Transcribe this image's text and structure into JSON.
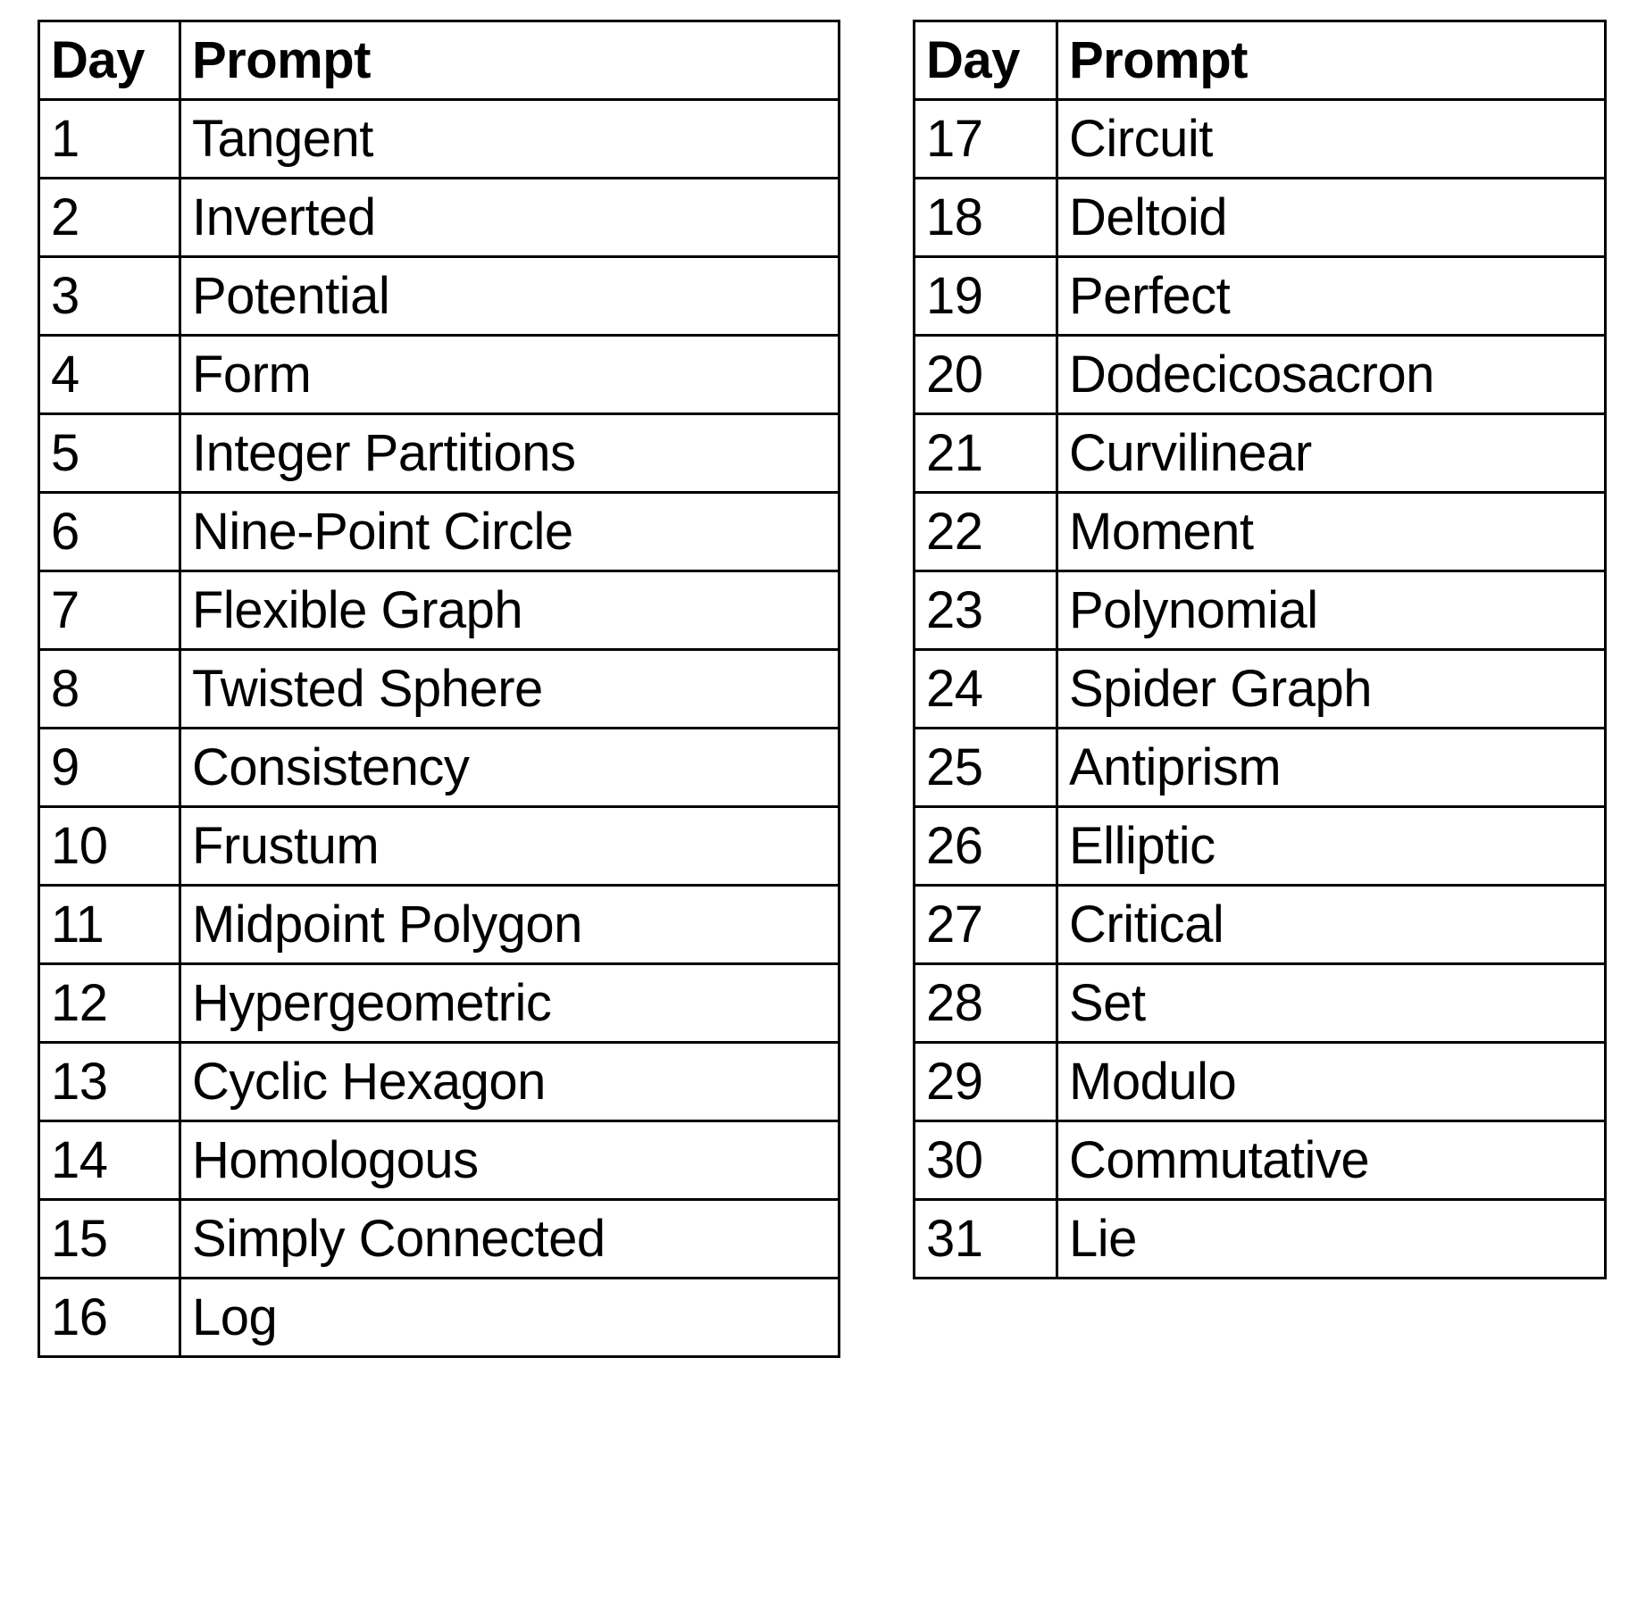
{
  "tables": [
    {
      "id": "left-table",
      "headers": {
        "day": "Day",
        "prompt": "Prompt"
      },
      "rows": [
        {
          "day": "1",
          "prompt": "Tangent"
        },
        {
          "day": "2",
          "prompt": "Inverted"
        },
        {
          "day": "3",
          "prompt": "Potential"
        },
        {
          "day": "4",
          "prompt": "Form"
        },
        {
          "day": "5",
          "prompt": "Integer Partitions"
        },
        {
          "day": "6",
          "prompt": "Nine-Point Circle"
        },
        {
          "day": "7",
          "prompt": "Flexible Graph"
        },
        {
          "day": "8",
          "prompt": "Twisted Sphere"
        },
        {
          "day": "9",
          "prompt": "Consistency"
        },
        {
          "day": "10",
          "prompt": "Frustum"
        },
        {
          "day": "11",
          "prompt": "Midpoint Polygon"
        },
        {
          "day": "12",
          "prompt": "Hypergeometric"
        },
        {
          "day": "13",
          "prompt": "Cyclic Hexagon"
        },
        {
          "day": "14",
          "prompt": "Homologous"
        },
        {
          "day": "15",
          "prompt": "Simply Connected"
        },
        {
          "day": "16",
          "prompt": "Log"
        }
      ]
    },
    {
      "id": "right-table",
      "headers": {
        "day": "Day",
        "prompt": "Prompt"
      },
      "rows": [
        {
          "day": "17",
          "prompt": "Circuit"
        },
        {
          "day": "18",
          "prompt": "Deltoid"
        },
        {
          "day": "19",
          "prompt": "Perfect"
        },
        {
          "day": "20",
          "prompt": "Dodecicosacron"
        },
        {
          "day": "21",
          "prompt": "Curvilinear"
        },
        {
          "day": "22",
          "prompt": "Moment"
        },
        {
          "day": "23",
          "prompt": "Polynomial"
        },
        {
          "day": "24",
          "prompt": "Spider Graph"
        },
        {
          "day": "25",
          "prompt": "Antiprism"
        },
        {
          "day": "26",
          "prompt": "Elliptic"
        },
        {
          "day": "27",
          "prompt": "Critical"
        },
        {
          "day": "28",
          "prompt": "Set"
        },
        {
          "day": "29",
          "prompt": "Modulo"
        },
        {
          "day": "30",
          "prompt": "Commutative"
        },
        {
          "day": "31",
          "prompt": "Lie"
        }
      ]
    }
  ],
  "colors": {
    "background": "#ffffff",
    "text": "#000000",
    "border": "#000000"
  }
}
